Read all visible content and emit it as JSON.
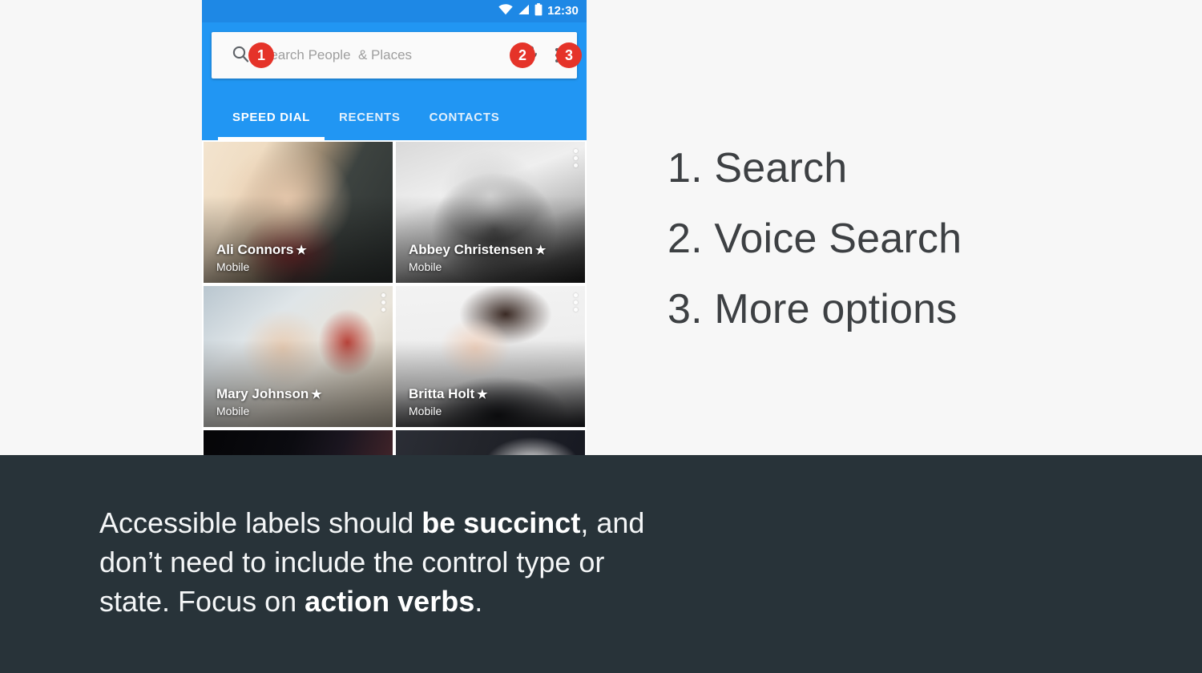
{
  "phone": {
    "status_bar": {
      "time": "12:30",
      "icons": [
        "wifi-icon",
        "cellular-signal-icon",
        "battery-icon"
      ]
    },
    "search": {
      "search_icon": "search-icon",
      "placeholder": "Search People  & Places",
      "value": "",
      "mic_icon": "microphone-icon",
      "overflow_icon": "more-options-icon",
      "badges": [
        {
          "number": "1",
          "target": "search-icon"
        },
        {
          "number": "2",
          "target": "microphone-icon"
        },
        {
          "number": "3",
          "target": "more-options-icon"
        }
      ]
    },
    "tabs": [
      {
        "label": "SPEED DIAL",
        "active": true
      },
      {
        "label": "RECENTS",
        "active": false
      },
      {
        "label": "CONTACTS",
        "active": false
      }
    ],
    "contacts": [
      {
        "name": "Ali Connors",
        "star": "★",
        "subtitle": "Mobile",
        "has_overflow": false
      },
      {
        "name": "Abbey Christensen",
        "star": "★",
        "subtitle": "Mobile",
        "has_overflow": true
      },
      {
        "name": "Mary Johnson",
        "star": "★",
        "subtitle": "Mobile",
        "has_overflow": true
      },
      {
        "name": "Britta Holt",
        "star": "★",
        "subtitle": "Mobile",
        "has_overflow": true
      }
    ]
  },
  "legend": {
    "items": [
      "1. Search",
      "2. Voice Search",
      "3. More options"
    ]
  },
  "caption": {
    "line1_a": "Accessible labels should ",
    "line1_b": "be succinct",
    "line1_c": ", and",
    "line2": "don’t need to include the control type or",
    "line3_a": "state. Focus on ",
    "line3_b": "action verbs",
    "line3_c": "."
  },
  "colors": {
    "app_bar_blue": "#2196F3",
    "status_bar_blue": "#1E88E5",
    "badge_red": "#E53329",
    "caption_band": "#283339",
    "page_background": "#F7F7F7",
    "legend_text": "#3D4043"
  }
}
